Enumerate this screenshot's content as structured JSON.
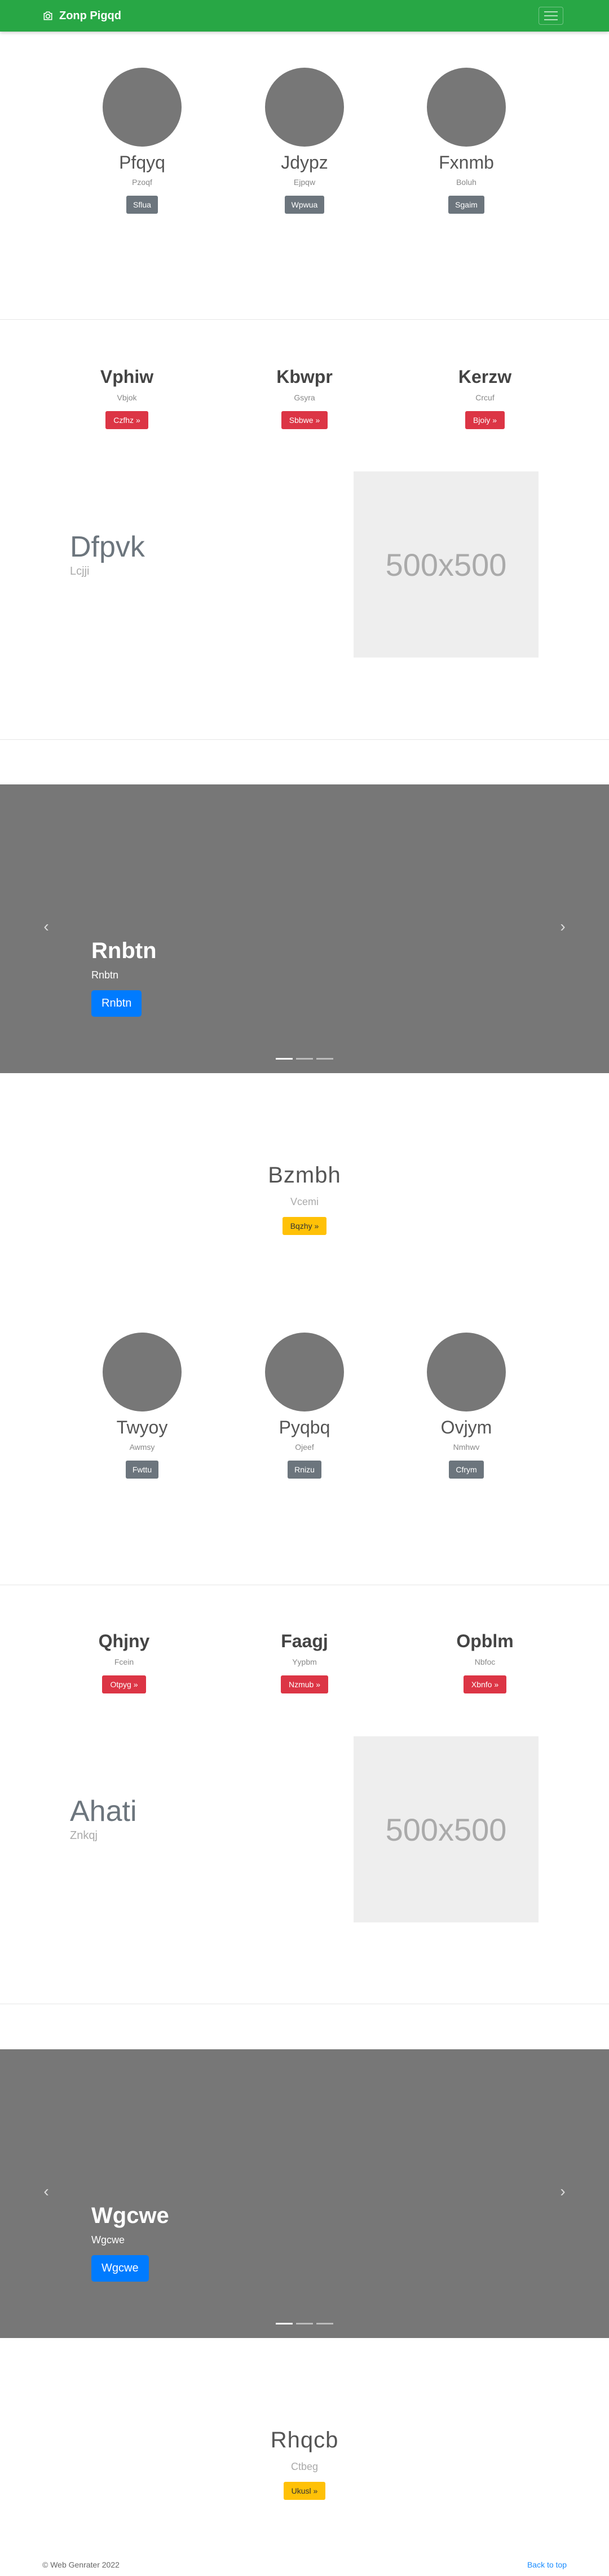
{
  "navbar": {
    "brand": "Zonp Pigqd",
    "brand_icon": "camera-icon",
    "toggler_icon": "hamburger-icon"
  },
  "profiles_1": [
    {
      "name": "Pfqyq",
      "sub": "Pzoqf",
      "button": "Sflua"
    },
    {
      "name": "Jdypz",
      "sub": "Ejpqw",
      "button": "Wpwua"
    },
    {
      "name": "Fxnmb",
      "sub": "Boluh",
      "button": "Sgaim"
    }
  ],
  "features_1": [
    {
      "title": "Vphiw",
      "sub": "Vbjok",
      "button": "Czfhz »"
    },
    {
      "title": "Kbwpr",
      "sub": "Gsyra",
      "button": "Sbbwe »"
    },
    {
      "title": "Kerzw",
      "sub": "Crcuf",
      "button": "Bjoiy »"
    }
  ],
  "featurette_1": {
    "heading": "Dfpvk",
    "sub": "Lcjji",
    "image_label": "500x500"
  },
  "carousel_1": {
    "title": "Rnbtn",
    "sub": "Rnbtn",
    "button": "Rnbtn",
    "prev_icon": "chevron-left-icon",
    "next_icon": "chevron-right-icon"
  },
  "cta_1": {
    "title": "Bzmbh",
    "sub": "Vcemi",
    "button": "Bqzhy »"
  },
  "profiles_2": [
    {
      "name": "Twyoy",
      "sub": "Awmsy",
      "button": "Fwttu"
    },
    {
      "name": "Pyqbq",
      "sub": "Ojeef",
      "button": "Rnizu"
    },
    {
      "name": "Ovjym",
      "sub": "Nmhwv",
      "button": "Cfrym"
    }
  ],
  "features_2": [
    {
      "title": "Qhjny",
      "sub": "Fcein",
      "button": "Otpyg »"
    },
    {
      "title": "Faagj",
      "sub": "Yypbm",
      "button": "Nzmub »"
    },
    {
      "title": "Opblm",
      "sub": "Nbfoc",
      "button": "Xbnfo »"
    }
  ],
  "featurette_2": {
    "heading": "Ahati",
    "sub": "Znkqj",
    "image_label": "500x500"
  },
  "carousel_2": {
    "title": "Wgcwe",
    "sub": "Wgcwe",
    "button": "Wgcwe",
    "prev_icon": "chevron-left-icon",
    "next_icon": "chevron-right-icon"
  },
  "cta_2": {
    "title": "Rhqcb",
    "sub": "Ctbeg",
    "button": "Ukusl »"
  },
  "footer": {
    "copyright": "© Web Genrater 2022",
    "back_to_top": "Back to top"
  },
  "colors": {
    "navbar": "#28a745",
    "danger": "#dc3545",
    "secondary": "#6c757d",
    "primary": "#007bff",
    "warning": "#ffc107",
    "carousel_bg": "#777777",
    "placeholder_bg": "#eeeeee"
  }
}
